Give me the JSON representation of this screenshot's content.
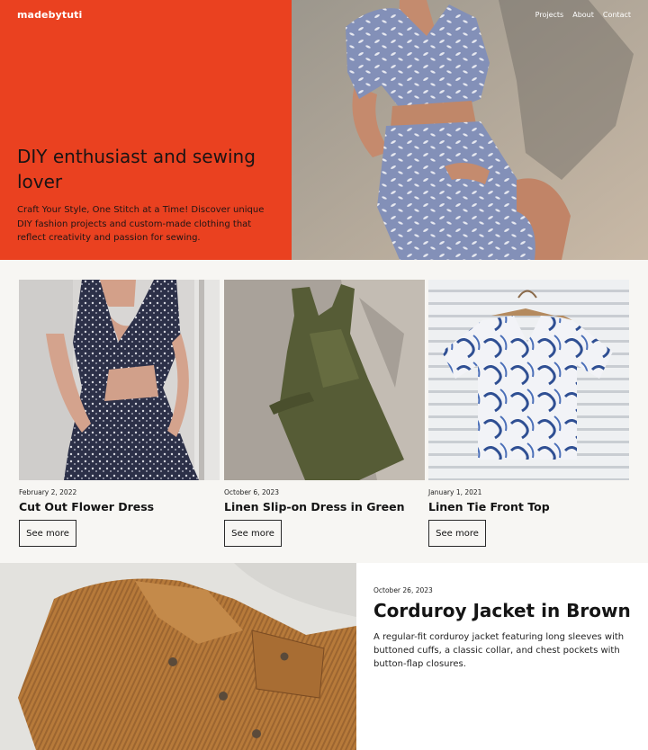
{
  "site": {
    "logo": "madebytuti"
  },
  "nav": {
    "items": [
      {
        "label": "Projects"
      },
      {
        "label": "About"
      },
      {
        "label": "Contact"
      }
    ]
  },
  "hero": {
    "title": "DIY enthusiast and sewing lover",
    "description": "Craft Your Style, One Stitch at a Time! Discover unique DIY fashion projects and custom-made clothing that reflect creativity and passion for sewing."
  },
  "projects": [
    {
      "date": "February 2, 2022",
      "title": "Cut Out Flower Dress",
      "button": "See more"
    },
    {
      "date": "October 6, 2023",
      "title": "Linen Slip-on Dress in Green",
      "button": "See more"
    },
    {
      "date": "January 1, 2021",
      "title": "Linen Tie Front Top",
      "button": "See more"
    }
  ],
  "featured": {
    "date": "October 26, 2023",
    "title": "Corduroy Jacket in Brown",
    "description": "A regular-fit corduroy jacket featuring long sleeves with buttoned cuffs, a classic collar, and chest pockets with button-flap closures."
  },
  "colors": {
    "accent": "#ea4120",
    "background": "#f7f6f3",
    "text": "#1b1b1b"
  }
}
